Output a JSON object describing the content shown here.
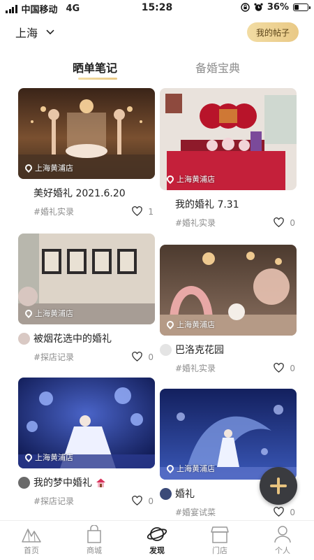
{
  "status_bar": {
    "carrier": "中国移动",
    "network": "4G",
    "time": "15:28",
    "battery": "36%",
    "battery_level": 0.36
  },
  "header": {
    "city": "上海",
    "my_posts": "我的帖子"
  },
  "tabs": {
    "active": "晒单笔记",
    "inactive": "备婚宝典"
  },
  "cards": [
    {
      "location": "上海黄浦店",
      "title": "美好婚礼 2021.6.20",
      "tag": "#婚礼实录",
      "likes": "1"
    },
    {
      "location": "上海黄浦店",
      "title": "我的婚礼 7.31",
      "tag": "#婚礼实录",
      "likes": "0"
    },
    {
      "location": "上海黄浦店",
      "title": "被烟花选中的婚礼",
      "tag": "#探店记录",
      "likes": "0"
    },
    {
      "location": "上海黄浦店",
      "title": "巴洛克花园",
      "tag": "#婚礼实录",
      "likes": "0"
    },
    {
      "location": "上海黄浦店",
      "title": "我的梦中婚礼",
      "tag": "#探店记录",
      "likes": "0"
    },
    {
      "location": "上海黄浦店",
      "title": "婚礼",
      "tag": "#婚宴试菜",
      "likes": "0"
    }
  ],
  "bottom_nav": [
    {
      "label": "首页",
      "icon": "mountain-home-icon"
    },
    {
      "label": "商城",
      "icon": "shopping-bag-icon"
    },
    {
      "label": "发现",
      "icon": "planet-icon"
    },
    {
      "label": "门店",
      "icon": "store-icon"
    },
    {
      "label": "个人",
      "icon": "person-icon"
    }
  ],
  "colors": {
    "accent_gold": "#e9c986",
    "fab_bg": "#3a3b3f",
    "fab_plus": "#e8c37f"
  }
}
